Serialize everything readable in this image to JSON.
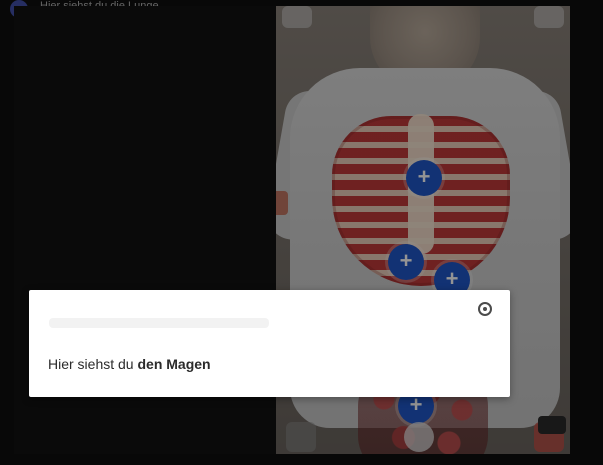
{
  "window": {
    "title": "Hier siehst du die Lunge"
  },
  "dialog": {
    "text_prefix": "Hier siehst du",
    "text_bold": "den Magen"
  },
  "markers": {
    "plus": "+"
  },
  "colors": {
    "marker_blue": "#1f56c9",
    "accent_red": "#c06b57"
  },
  "icons": {
    "close": "close-icon",
    "marker": "plus-circle-icon"
  }
}
